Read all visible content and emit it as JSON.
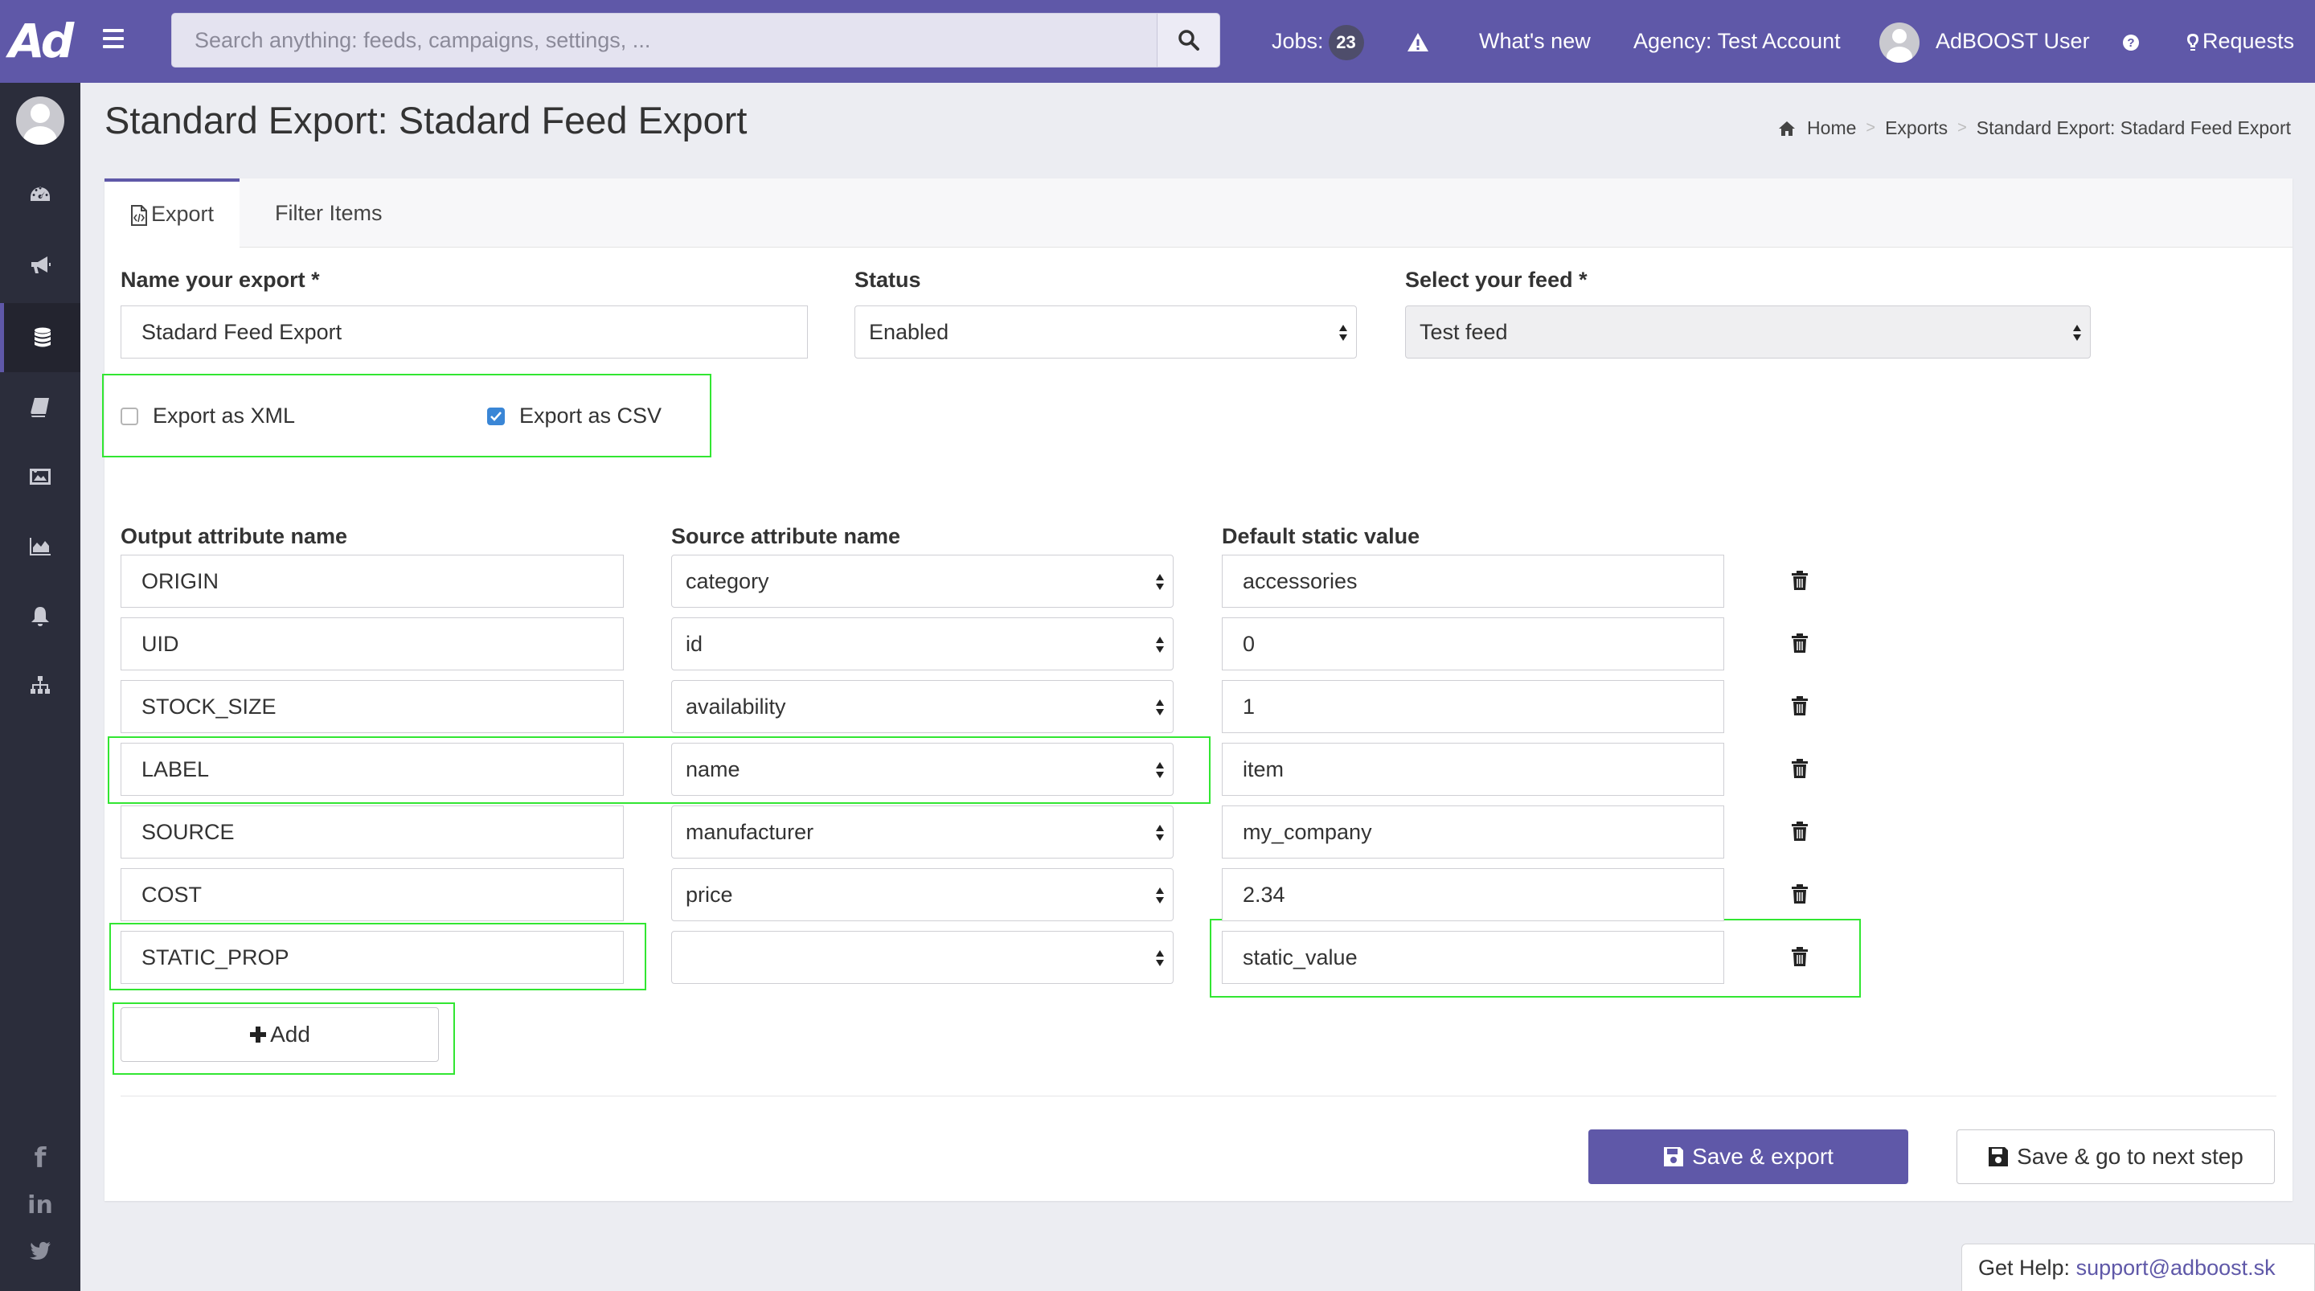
{
  "brand": {
    "logo_text": "Ad",
    "accent": "#5f58a8"
  },
  "sidebar": {
    "items": [
      {
        "icon": "dashboard-icon"
      },
      {
        "icon": "megaphone-icon"
      },
      {
        "icon": "database-icon",
        "active": true
      },
      {
        "icon": "book-icon"
      },
      {
        "icon": "image-icon"
      },
      {
        "icon": "area-chart-icon"
      },
      {
        "icon": "bell-icon"
      },
      {
        "icon": "sitemap-icon"
      }
    ],
    "social": [
      {
        "icon": "facebook-icon",
        "glyph": "f"
      },
      {
        "icon": "linkedin-icon",
        "glyph": "in"
      },
      {
        "icon": "twitter-icon",
        "glyph": ""
      }
    ]
  },
  "topbar": {
    "search_placeholder": "Search anything: feeds, campaigns, settings, ...",
    "jobs_label": "Jobs:",
    "jobs_count": "23",
    "whats_new": "What's new",
    "agency": "Agency: Test Account",
    "user_name": "AdBOOST User",
    "requests": "Requests"
  },
  "page": {
    "title": "Standard Export: Stadard Feed Export",
    "breadcrumb": [
      "Home",
      "Exports",
      "Standard Export: Stadard Feed Export"
    ]
  },
  "tabs": [
    {
      "label": "Export",
      "active": true
    },
    {
      "label": "Filter Items",
      "active": false
    }
  ],
  "form": {
    "name_label": "Name your export *",
    "name_value": "Stadard Feed Export",
    "status_label": "Status",
    "status_value": "Enabled",
    "feed_label": "Select your feed *",
    "feed_value": "Test feed",
    "export_xml": {
      "label": "Export as XML",
      "checked": false
    },
    "export_csv": {
      "label": "Export as CSV",
      "checked": true
    }
  },
  "mapping": {
    "headers": {
      "output": "Output attribute name",
      "source": "Source attribute name",
      "default": "Default static value"
    },
    "rows": [
      {
        "output": "ORIGIN",
        "source": "category",
        "default": "accessories"
      },
      {
        "output": "UID",
        "source": "id",
        "default": "0"
      },
      {
        "output": "STOCK_SIZE",
        "source": "availability",
        "default": "1"
      },
      {
        "output": "LABEL",
        "source": "name",
        "default": "item"
      },
      {
        "output": "SOURCE",
        "source": "manufacturer",
        "default": "my_company"
      },
      {
        "output": "COST",
        "source": "price",
        "default": "2.34"
      },
      {
        "output": "STATIC_PROP",
        "source": "",
        "default": "static_value"
      }
    ],
    "add_label": "Add"
  },
  "actions": {
    "save_export": "Save & export",
    "save_next": "Save & go to next step"
  },
  "help": {
    "label": "Get Help:",
    "email": "support@adboost.sk"
  }
}
